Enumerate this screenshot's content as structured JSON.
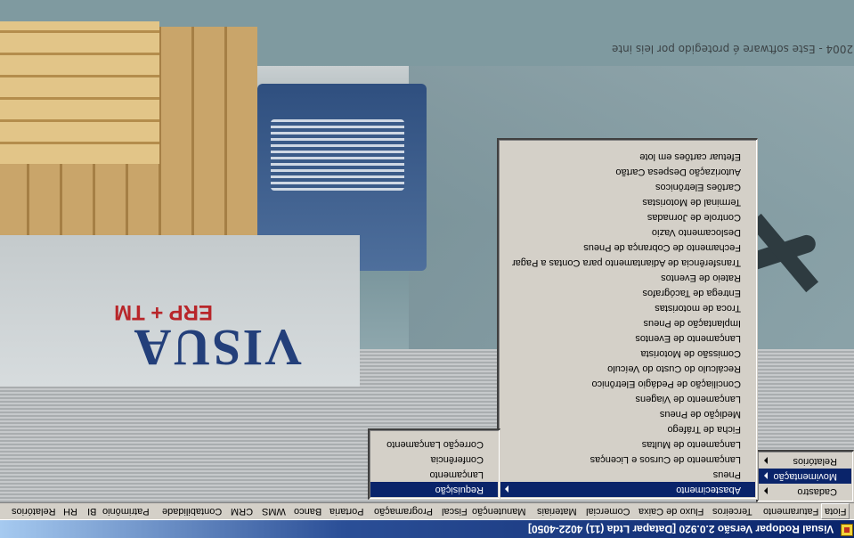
{
  "window": {
    "title": "Visual Rodopar Versão 2.0.920 [Datapar Ltda (11) 4022-4050]",
    "icon": "app-icon"
  },
  "background": {
    "logo_text": "VISUA",
    "logo_subtext": "ERP + TM",
    "copyright": "© 2004 - Este software é protegido por leis inte"
  },
  "menubar": {
    "items": [
      {
        "label": "Fiota"
      },
      {
        "label": "Faturamento"
      },
      {
        "label": "Terceiros"
      },
      {
        "label": "Fluxo de Caixa"
      },
      {
        "label": "Comercial"
      },
      {
        "label": "Materiais"
      },
      {
        "label": "Manutenção"
      },
      {
        "label": "Fiscal"
      },
      {
        "label": "Programação"
      },
      {
        "label": "Portaria"
      },
      {
        "label": "Banco"
      },
      {
        "label": "WMS"
      },
      {
        "label": "CRM"
      },
      {
        "label": "Contabilidade"
      },
      {
        "label": "Patrimônio"
      },
      {
        "label": "BI"
      },
      {
        "label": "RH"
      },
      {
        "label": "Relatórios"
      }
    ]
  },
  "menu_fiota": {
    "items": [
      {
        "label": "Cadastro"
      },
      {
        "label": "Movimentação"
      },
      {
        "label": "Relatórios"
      }
    ]
  },
  "menu_movimentacao": {
    "items": [
      {
        "label": "Abastecimento"
      },
      {
        "label": "Pneus"
      },
      {
        "label": "Lançamento de Cursos e Licenças"
      },
      {
        "label": "Lançamento de Multas"
      },
      {
        "label": "Ficha de Tráfego"
      },
      {
        "label": "Medição de Pneus"
      },
      {
        "label": "Lançamento de Viagens"
      },
      {
        "label": "Conciliação de Pedágio Eletrônico"
      },
      {
        "label": "Recálculo do Custo do Veículo"
      },
      {
        "label": "Comissão de Motorista"
      },
      {
        "label": "Lançamento de Eventos"
      },
      {
        "label": "Implantação de Pneus"
      },
      {
        "label": "Troca de motoristas"
      },
      {
        "label": "Entrega de Tacógrafos"
      },
      {
        "label": "Rateio de Eventos"
      },
      {
        "label": "Transferência de Adiantamento para Contas a Pagar"
      },
      {
        "label": "Fechamento de Cobrança de Pneus"
      },
      {
        "label": "Deslocamento Vazio"
      },
      {
        "label": "Controle de Jornadas"
      },
      {
        "label": "Terminal de Motoristas"
      },
      {
        "label": "Cartões Eletrônicos"
      },
      {
        "label": "Autorização Despesa Cartão"
      },
      {
        "label": "Efetuar cartões em lote"
      }
    ]
  },
  "menu_abastecimento": {
    "items": [
      {
        "label": "Requisição"
      },
      {
        "label": "Lançamento"
      },
      {
        "label": "Conferência"
      },
      {
        "label": "Correção Lançamento"
      }
    ]
  }
}
